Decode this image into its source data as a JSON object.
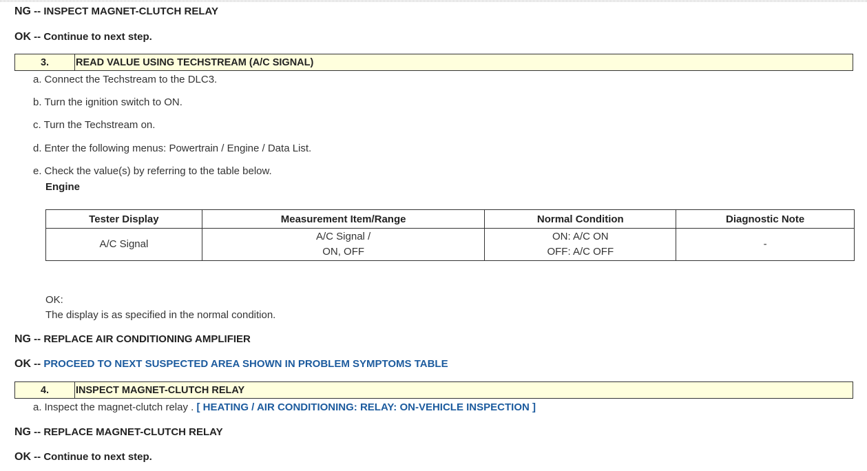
{
  "results": {
    "r1": {
      "code": "NG",
      "sep": " -- ",
      "text": "INSPECT MAGNET-CLUTCH RELAY"
    },
    "r2": {
      "code": "OK",
      "sep": " -- ",
      "text": "Continue to next step."
    },
    "r3": {
      "code": "NG",
      "sep": " -- ",
      "text": "REPLACE AIR CONDITIONING AMPLIFIER"
    },
    "r4": {
      "code": "OK",
      "sep": " -- ",
      "text": "PROCEED TO NEXT SUSPECTED AREA SHOWN IN PROBLEM SYMPTOMS TABLE"
    },
    "r5": {
      "code": "NG",
      "sep": " -- ",
      "text": "REPLACE MAGNET-CLUTCH RELAY"
    },
    "r6": {
      "code": "OK",
      "sep": " -- ",
      "text": "Continue to next step."
    }
  },
  "step3": {
    "number": "3.",
    "title": "READ VALUE USING TECHSTREAM (A/C SIGNAL)",
    "substeps": [
      {
        "label": "a.",
        "text": "Connect the Techstream to the DLC3."
      },
      {
        "label": "b.",
        "text": "Turn the ignition switch to ON."
      },
      {
        "label": "c.",
        "text": "Turn the Techstream on."
      },
      {
        "label": "d.",
        "text": "Enter the following menus: Powertrain / Engine / Data List."
      },
      {
        "label": "e.",
        "text": "Check the value(s) by referring to the table below."
      }
    ],
    "table_caption": "Engine",
    "table": {
      "headers": [
        "Tester Display",
        "Measurement Item/Range",
        "Normal Condition",
        "Diagnostic Note"
      ],
      "row": {
        "tester_display": "A/C Signal",
        "measurement_line1": "A/C Signal /",
        "measurement_line2": "ON, OFF",
        "normal_line1": "ON: A/C ON",
        "normal_line2": "OFF: A/C OFF",
        "diagnostic_note": "-"
      }
    },
    "ok_label": "OK:",
    "ok_text": "The display is as specified in the normal condition."
  },
  "step4": {
    "number": "4.",
    "title": "INSPECT MAGNET-CLUTCH RELAY",
    "substep_label": "a.",
    "substep_text": "Inspect the magnet-clutch relay .",
    "substep_link": "[ HEATING / AIR CONDITIONING: RELAY: ON-VEHICLE INSPECTION ]"
  },
  "colors": {
    "step_box_bg": "#ffffdd",
    "link": "#1c5b9e"
  }
}
